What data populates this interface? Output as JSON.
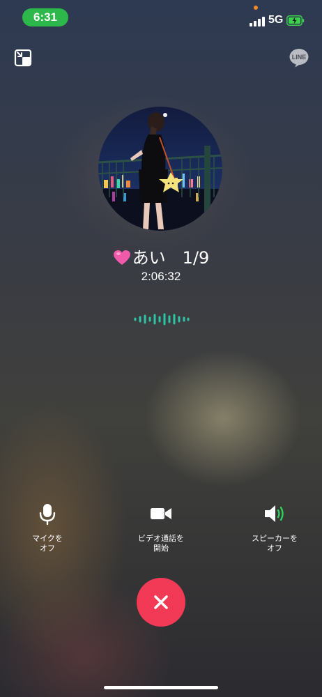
{
  "status_bar": {
    "time": "6:31",
    "network": "5G",
    "time_pill_color": "#2db84b",
    "battery_color": "#3ccf4e",
    "privacy_dot_color": "#f08a24"
  },
  "header": {
    "minimize_icon": "minimize-window-icon",
    "app_logo": "LINE"
  },
  "caller": {
    "name": "あい　1/9",
    "heart_icon": "pink-heart-icon",
    "duration": "2:06:32"
  },
  "audio_indicator": {
    "color": "#2ec4a6"
  },
  "controls": {
    "mute": {
      "label": "マイクを\nオフ",
      "icon": "microphone-icon"
    },
    "video": {
      "label": "ビデオ通話を\n開始",
      "icon": "video-camera-icon"
    },
    "speaker": {
      "label": "スピーカーを\nオフ",
      "icon": "speaker-on-icon"
    }
  },
  "end_call": {
    "icon": "close-icon",
    "color": "#f23a56"
  }
}
